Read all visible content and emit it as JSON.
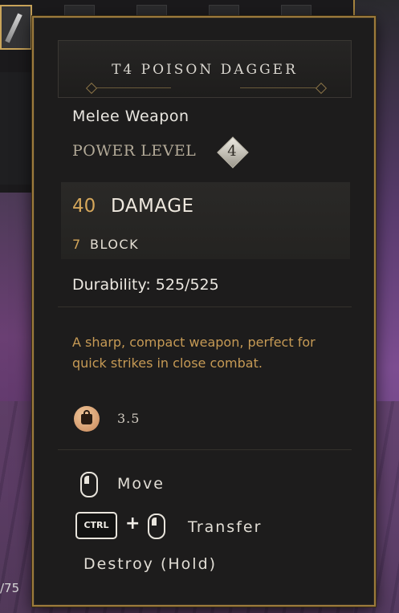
{
  "item": {
    "title": "T4 POISON DAGGER",
    "type": "Melee Weapon",
    "power_level_label": "POWER LEVEL",
    "power_level": "4",
    "damage_value": "40",
    "damage_label": "DAMAGE",
    "block_value": "7",
    "block_label": "BLOCK",
    "durability": "Durability: 525/525",
    "description": "A sharp, compact weapon, perfect for quick strikes in close combat.",
    "weight": "3.5"
  },
  "actions": {
    "move": "Move",
    "ctrl_key": "CTRL",
    "plus": "+",
    "transfer": "Transfer",
    "destroy": "Destroy (Hold)"
  },
  "background": {
    "counter_text": "/75"
  },
  "icons": {
    "weight": "kettlebell-icon",
    "mouse": "mouse-icon",
    "power": "diamond-badge"
  },
  "colors": {
    "accent_gold": "#d4a65a",
    "border_gold": "#9c7a3c",
    "description": "#c69a55"
  }
}
